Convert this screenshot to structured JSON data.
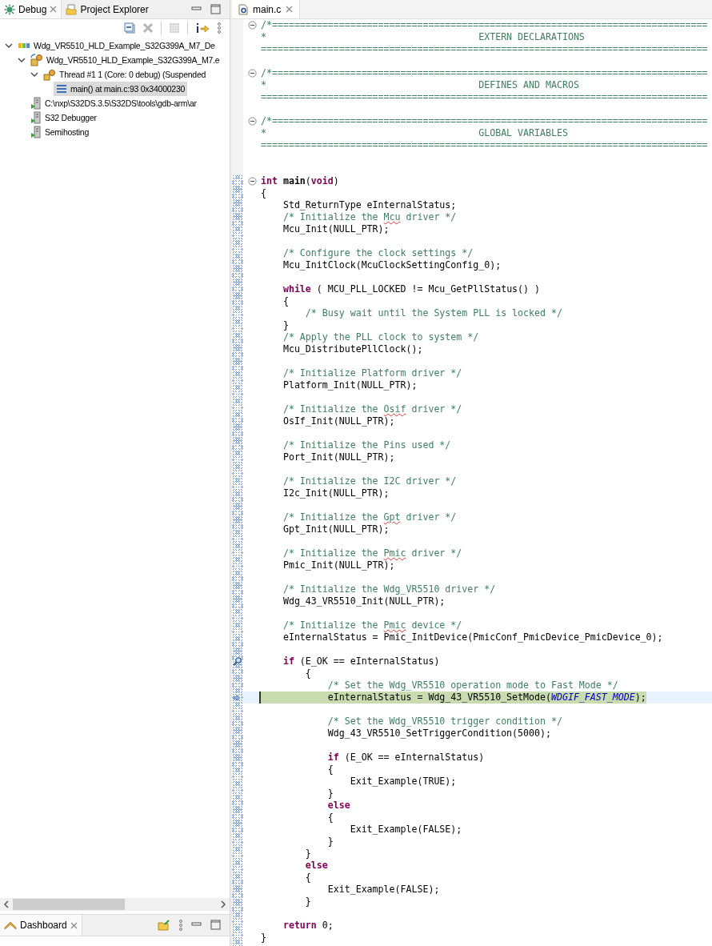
{
  "debug_view": {
    "tabs": [
      {
        "label": "Debug",
        "kind": "debug",
        "selected": true
      },
      {
        "label": "Project Explorer",
        "kind": "explorer",
        "selected": false
      }
    ],
    "tree": [
      {
        "label": "Wdg_VR5510_HLD_Example_S32G399A_M7_De",
        "kind": "launch",
        "expanded": true,
        "selected": false,
        "children": [
          {
            "label": "Wdg_VR5510_HLD_Example_S32G399A_M7.e",
            "kind": "process",
            "expanded": true,
            "selected": false,
            "children": [
              {
                "label": "Thread #1 1 (Core: 0 debug) (Suspended",
                "kind": "thread",
                "expanded": true,
                "selected": false,
                "children": [
                  {
                    "label": "main() at main.c:93 0x34000230",
                    "kind": "frame",
                    "selected": true
                  }
                ]
              }
            ]
          },
          {
            "label": "C:\\nxp\\S32DS.3.5\\S32DS\\tools\\gdb-arm\\ar",
            "kind": "target",
            "selected": false
          },
          {
            "label": "S32 Debugger",
            "kind": "target",
            "selected": false
          },
          {
            "label": "Semihosting",
            "kind": "target",
            "selected": false
          }
        ]
      }
    ]
  },
  "dashboard": {
    "tabs": [
      {
        "label": "Dashboard",
        "selected": true
      }
    ]
  },
  "editor": {
    "tab": {
      "label": "main.c",
      "selected": true
    },
    "lines": [
      {
        "fold": true,
        "segments": [
          {
            "kind": "comment",
            "text": "/*=============================================================================="
          }
        ]
      },
      {
        "segments": [
          {
            "kind": "comment",
            "text": "*                                      EXTERN DECLARATIONS"
          }
        ]
      },
      {
        "segments": [
          {
            "kind": "comment",
            "text": "================================================================================"
          }
        ]
      },
      {
        "kind": "blank"
      },
      {
        "fold": true,
        "segments": [
          {
            "kind": "comment",
            "text": "/*=============================================================================="
          }
        ]
      },
      {
        "segments": [
          {
            "kind": "comment",
            "text": "*                                      DEFINES AND MACROS"
          }
        ]
      },
      {
        "segments": [
          {
            "kind": "comment",
            "text": "================================================================================"
          }
        ]
      },
      {
        "kind": "blank"
      },
      {
        "fold": true,
        "segments": [
          {
            "kind": "comment",
            "text": "/*=============================================================================="
          }
        ]
      },
      {
        "segments": [
          {
            "kind": "comment",
            "text": "*                                      GLOBAL VARIABLES"
          }
        ]
      },
      {
        "segments": [
          {
            "kind": "comment",
            "text": "================================================================================"
          }
        ]
      },
      {
        "kind": "blank"
      },
      {
        "kind": "blank"
      },
      {
        "fold": true,
        "range_start": true,
        "segments": [
          {
            "kind": "keyword",
            "text": "int"
          },
          {
            "kind": "function",
            "text": " main"
          },
          {
            "kind": "plain",
            "text": "("
          },
          {
            "kind": "keyword",
            "text": "void"
          },
          {
            "kind": "plain",
            "text": ")"
          }
        ]
      },
      {
        "segments": [
          {
            "kind": "plain",
            "text": "{"
          }
        ]
      },
      {
        "segments": [
          {
            "kind": "plain",
            "text": "    Std_ReturnType eInternalStatus;"
          }
        ]
      },
      {
        "segments": [
          {
            "kind": "comment",
            "text": "    /* Initialize the "
          },
          {
            "kind": "misspelled",
            "text": "Mcu"
          },
          {
            "kind": "comment",
            "text": " driver */"
          }
        ]
      },
      {
        "segments": [
          {
            "kind": "plain",
            "text": "    Mcu_Init(NULL_PTR);"
          }
        ]
      },
      {
        "kind": "blank"
      },
      {
        "segments": [
          {
            "kind": "comment",
            "text": "    /* Configure the clock settings */"
          }
        ]
      },
      {
        "segments": [
          {
            "kind": "plain",
            "text": "    Mcu_InitClock(McuClockSettingConfig_0);"
          }
        ]
      },
      {
        "kind": "blank"
      },
      {
        "segments": [
          {
            "kind": "keyword",
            "text": "    while"
          },
          {
            "kind": "plain",
            "text": " ( MCU_PLL_LOCKED != Mcu_GetPllStatus() )"
          }
        ]
      },
      {
        "segments": [
          {
            "kind": "plain",
            "text": "    {"
          }
        ]
      },
      {
        "segments": [
          {
            "kind": "comment",
            "text": "        /* Busy wait until the System PLL is locked */"
          }
        ]
      },
      {
        "segments": [
          {
            "kind": "plain",
            "text": "    }"
          }
        ]
      },
      {
        "segments": [
          {
            "kind": "comment",
            "text": "    /* Apply the PLL clock to system */"
          }
        ]
      },
      {
        "segments": [
          {
            "kind": "plain",
            "text": "    Mcu_DistributePllClock();"
          }
        ]
      },
      {
        "kind": "blank"
      },
      {
        "segments": [
          {
            "kind": "comment",
            "text": "    /* Initialize Platform driver */"
          }
        ]
      },
      {
        "segments": [
          {
            "kind": "plain",
            "text": "    Platform_Init(NULL_PTR);"
          }
        ]
      },
      {
        "kind": "blank"
      },
      {
        "segments": [
          {
            "kind": "comment",
            "text": "    /* Initialize the "
          },
          {
            "kind": "misspelled",
            "text": "Osif"
          },
          {
            "kind": "comment",
            "text": " driver */"
          }
        ]
      },
      {
        "segments": [
          {
            "kind": "plain",
            "text": "    OsIf_Init(NULL_PTR);"
          }
        ]
      },
      {
        "kind": "blank"
      },
      {
        "segments": [
          {
            "kind": "comment",
            "text": "    /* Initialize the Pins used */"
          }
        ]
      },
      {
        "segments": [
          {
            "kind": "plain",
            "text": "    Port_Init(NULL_PTR);"
          }
        ]
      },
      {
        "kind": "blank"
      },
      {
        "segments": [
          {
            "kind": "comment",
            "text": "    /* Initialize the I2C driver */"
          }
        ]
      },
      {
        "segments": [
          {
            "kind": "plain",
            "text": "    I2c_Init(NULL_PTR);"
          }
        ]
      },
      {
        "kind": "blank"
      },
      {
        "segments": [
          {
            "kind": "comment",
            "text": "    /* Initialize the "
          },
          {
            "kind": "misspelled",
            "text": "Gpt"
          },
          {
            "kind": "comment",
            "text": " driver */"
          }
        ]
      },
      {
        "segments": [
          {
            "kind": "plain",
            "text": "    Gpt_Init(NULL_PTR);"
          }
        ]
      },
      {
        "kind": "blank"
      },
      {
        "segments": [
          {
            "kind": "comment",
            "text": "    /* Initialize the "
          },
          {
            "kind": "misspelled",
            "text": "Pmic"
          },
          {
            "kind": "comment",
            "text": " driver */"
          }
        ]
      },
      {
        "segments": [
          {
            "kind": "plain",
            "text": "    Pmic_Init(NULL_PTR);"
          }
        ]
      },
      {
        "kind": "blank"
      },
      {
        "segments": [
          {
            "kind": "comment",
            "text": "    /* Initialize the Wdg_VR5510 driver */"
          }
        ]
      },
      {
        "segments": [
          {
            "kind": "plain",
            "text": "    Wdg_43_VR5510_Init(NULL_PTR);"
          }
        ]
      },
      {
        "kind": "blank"
      },
      {
        "segments": [
          {
            "kind": "comment",
            "text": "    /* Initialize the "
          },
          {
            "kind": "misspelled",
            "text": "Pmic"
          },
          {
            "kind": "comment",
            "text": " device */"
          }
        ]
      },
      {
        "segments": [
          {
            "kind": "plain",
            "text": "    eInternalStatus = Pmic_InitDevice(PmicConf_PmicDevice_PmicDevice_0);"
          }
        ]
      },
      {
        "kind": "blank"
      },
      {
        "search_marker": true,
        "segments": [
          {
            "kind": "keyword",
            "text": "    if"
          },
          {
            "kind": "plain",
            "text": " (E_OK == eInternalStatus)"
          }
        ]
      },
      {
        "segments": [
          {
            "kind": "plain",
            "text": "        {"
          }
        ]
      },
      {
        "segments": [
          {
            "kind": "comment",
            "text": "            /* Set the Wdg_VR5510 operation mode to Fast Mode */"
          }
        ]
      },
      {
        "instruction_pointer": true,
        "current": true,
        "segments": [
          {
            "kind": "plain",
            "text": "            eInternalStatus = Wdg_43_VR5510_SetMode("
          },
          {
            "kind": "enum",
            "text": "WDGIF_FAST_MODE"
          },
          {
            "kind": "plain",
            "text": ");"
          }
        ]
      },
      {
        "kind": "blank"
      },
      {
        "segments": [
          {
            "kind": "comment",
            "text": "            /* Set the Wdg_VR5510 trigger condition */"
          }
        ]
      },
      {
        "segments": [
          {
            "kind": "plain",
            "text": "            Wdg_43_VR5510_SetTriggerCondition(5000);"
          }
        ]
      },
      {
        "kind": "blank"
      },
      {
        "segments": [
          {
            "kind": "keyword",
            "text": "            if"
          },
          {
            "kind": "plain",
            "text": " (E_OK == eInternalStatus)"
          }
        ]
      },
      {
        "segments": [
          {
            "kind": "plain",
            "text": "            {"
          }
        ]
      },
      {
        "segments": [
          {
            "kind": "plain",
            "text": "                Exit_Example(TRUE);"
          }
        ]
      },
      {
        "segments": [
          {
            "kind": "plain",
            "text": "            }"
          }
        ]
      },
      {
        "segments": [
          {
            "kind": "keyword",
            "text": "            else"
          }
        ]
      },
      {
        "segments": [
          {
            "kind": "plain",
            "text": "            {"
          }
        ]
      },
      {
        "segments": [
          {
            "kind": "plain",
            "text": "                Exit_Example(FALSE);"
          }
        ]
      },
      {
        "segments": [
          {
            "kind": "plain",
            "text": "            }"
          }
        ]
      },
      {
        "segments": [
          {
            "kind": "plain",
            "text": "        }"
          }
        ]
      },
      {
        "segments": [
          {
            "kind": "keyword",
            "text": "        else"
          }
        ]
      },
      {
        "segments": [
          {
            "kind": "plain",
            "text": "        {"
          }
        ]
      },
      {
        "segments": [
          {
            "kind": "plain",
            "text": "            Exit_Example(FALSE);"
          }
        ]
      },
      {
        "segments": [
          {
            "kind": "plain",
            "text": "        }"
          }
        ]
      },
      {
        "kind": "blank"
      },
      {
        "segments": [
          {
            "kind": "keyword",
            "text": "    return"
          },
          {
            "kind": "plain",
            "text": " 0;"
          }
        ]
      },
      {
        "segments": [
          {
            "kind": "plain",
            "text": "}"
          }
        ]
      }
    ]
  }
}
